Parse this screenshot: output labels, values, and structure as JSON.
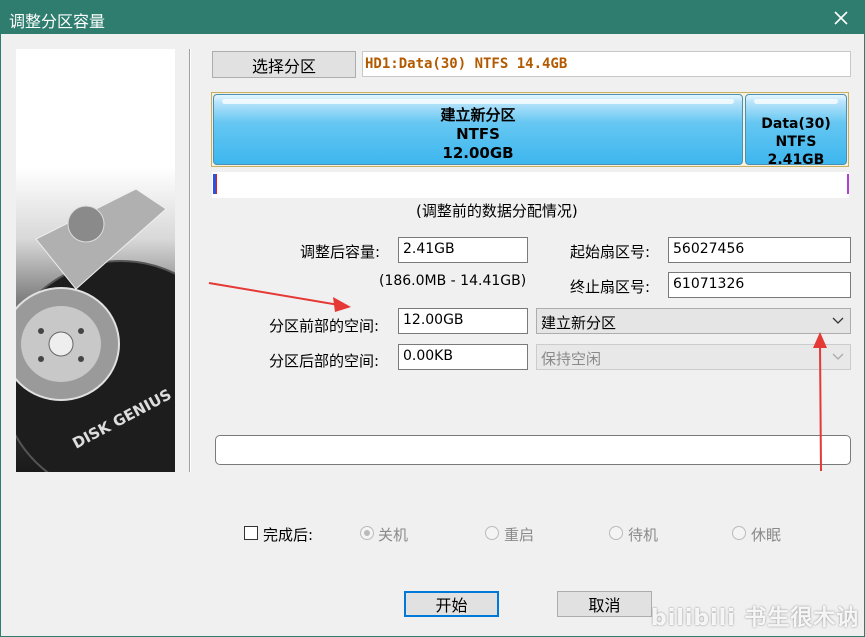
{
  "window": {
    "title": "调整分区容量"
  },
  "select_partition_label": "选择分区",
  "partition_info": "HD1:Data(30) NTFS 14.4GB",
  "disk_map": {
    "segments": [
      {
        "name": "建立新分区",
        "fs": "NTFS",
        "size": "12.00GB"
      },
      {
        "name": "Data(30)",
        "fs_size": "NTFS 2.41GB"
      }
    ]
  },
  "caption": "(调整前的数据分配情况)",
  "form": {
    "size_after_label": "调整后容量:",
    "size_after_value": "2.41GB",
    "size_range": "(186.0MB - 14.41GB)",
    "start_sector_label": "起始扇区号:",
    "start_sector_value": "56027456",
    "end_sector_label": "终止扇区号:",
    "end_sector_value": "61071326",
    "front_space_label": "分区前部的空间:",
    "front_space_value": "12.00GB",
    "front_action": "建立新分区",
    "back_space_label": "分区后部的空间:",
    "back_space_value": "0.00KB",
    "back_action": "保持空闲"
  },
  "after_completion": {
    "label": "完成后:",
    "options": [
      "关机",
      "重启",
      "待机",
      "休眠"
    ]
  },
  "buttons": {
    "start": "开始",
    "cancel": "取消"
  },
  "watermark": "bilibili 书生很木讷",
  "icons": [
    "close-icon",
    "chevron-down-icon",
    "hard-disk-image"
  ],
  "colors": {
    "titlebar": "#2e7d6f",
    "partition_bar": "#3db6ee",
    "annotation_arrow": "#e53935",
    "info_text": "#b35a00"
  }
}
